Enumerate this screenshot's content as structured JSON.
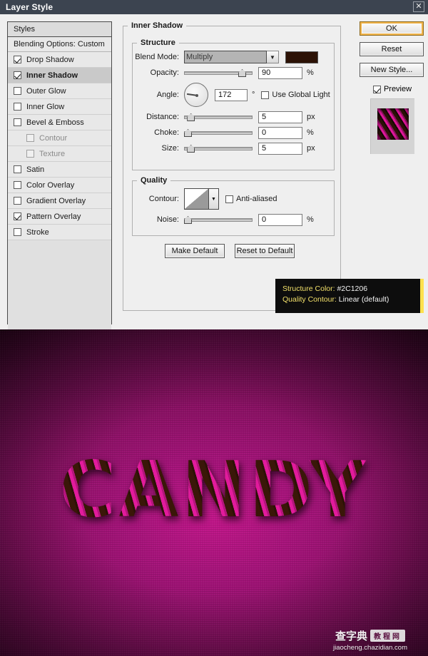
{
  "window": {
    "title": "Layer Style",
    "close_label": "✕"
  },
  "styles_panel": {
    "header": "Styles",
    "blending_options": "Blending Options: Custom",
    "items": [
      {
        "label": "Drop Shadow",
        "checked": true,
        "indent": false,
        "active": false,
        "dim": false
      },
      {
        "label": "Inner Shadow",
        "checked": true,
        "indent": false,
        "active": true,
        "dim": false
      },
      {
        "label": "Outer Glow",
        "checked": false,
        "indent": false,
        "active": false,
        "dim": false
      },
      {
        "label": "Inner Glow",
        "checked": false,
        "indent": false,
        "active": false,
        "dim": false
      },
      {
        "label": "Bevel & Emboss",
        "checked": false,
        "indent": false,
        "active": false,
        "dim": false
      },
      {
        "label": "Contour",
        "checked": false,
        "indent": true,
        "active": false,
        "dim": true
      },
      {
        "label": "Texture",
        "checked": false,
        "indent": true,
        "active": false,
        "dim": true
      },
      {
        "label": "Satin",
        "checked": false,
        "indent": false,
        "active": false,
        "dim": false
      },
      {
        "label": "Color Overlay",
        "checked": false,
        "indent": false,
        "active": false,
        "dim": false
      },
      {
        "label": "Gradient Overlay",
        "checked": false,
        "indent": false,
        "active": false,
        "dim": false
      },
      {
        "label": "Pattern Overlay",
        "checked": true,
        "indent": false,
        "active": false,
        "dim": false
      },
      {
        "label": "Stroke",
        "checked": false,
        "indent": false,
        "active": false,
        "dim": false
      }
    ]
  },
  "settings": {
    "group_title": "Inner Shadow",
    "structure": {
      "title": "Structure",
      "blend_mode_label": "Blend Mode:",
      "blend_mode_value": "Multiply",
      "shadow_color": "#2C1206",
      "opacity_label": "Opacity:",
      "opacity_value": "90",
      "opacity_unit": "%",
      "angle_label": "Angle:",
      "angle_value": "172",
      "angle_unit": "°",
      "use_global_light_label": "Use Global Light",
      "use_global_light_checked": false,
      "distance_label": "Distance:",
      "distance_value": "5",
      "distance_unit": "px",
      "choke_label": "Choke:",
      "choke_value": "0",
      "choke_unit": "%",
      "size_label": "Size:",
      "size_value": "5",
      "size_unit": "px"
    },
    "quality": {
      "title": "Quality",
      "contour_label": "Contour:",
      "contour_value": "Linear (default)",
      "anti_aliased_label": "Anti-aliased",
      "anti_aliased_checked": false,
      "noise_label": "Noise:",
      "noise_value": "0",
      "noise_unit": "%"
    },
    "make_default_label": "Make Default",
    "reset_to_default_label": "Reset to Default"
  },
  "right_column": {
    "ok_label": "OK",
    "reset_label": "Reset",
    "new_style_label": "New Style...",
    "preview_label": "Preview",
    "preview_checked": true
  },
  "tooltip": {
    "line1_key": "Structure Color:",
    "line1_value": "#2C1206",
    "line2_key": "Quality Contour:",
    "line2_value": "Linear (default)",
    "accent_color": "#FFE14D",
    "text_color": "#F2E06A"
  },
  "artwork": {
    "text": "CANDY",
    "background_color": "#A5137A",
    "stripe_light": "#E21B9C",
    "stripe_dark": "#2C1206"
  },
  "watermark": {
    "brand_cn": "查字典",
    "badge_cn": "教程网",
    "url": "jiaocheng.chazidian.com"
  }
}
